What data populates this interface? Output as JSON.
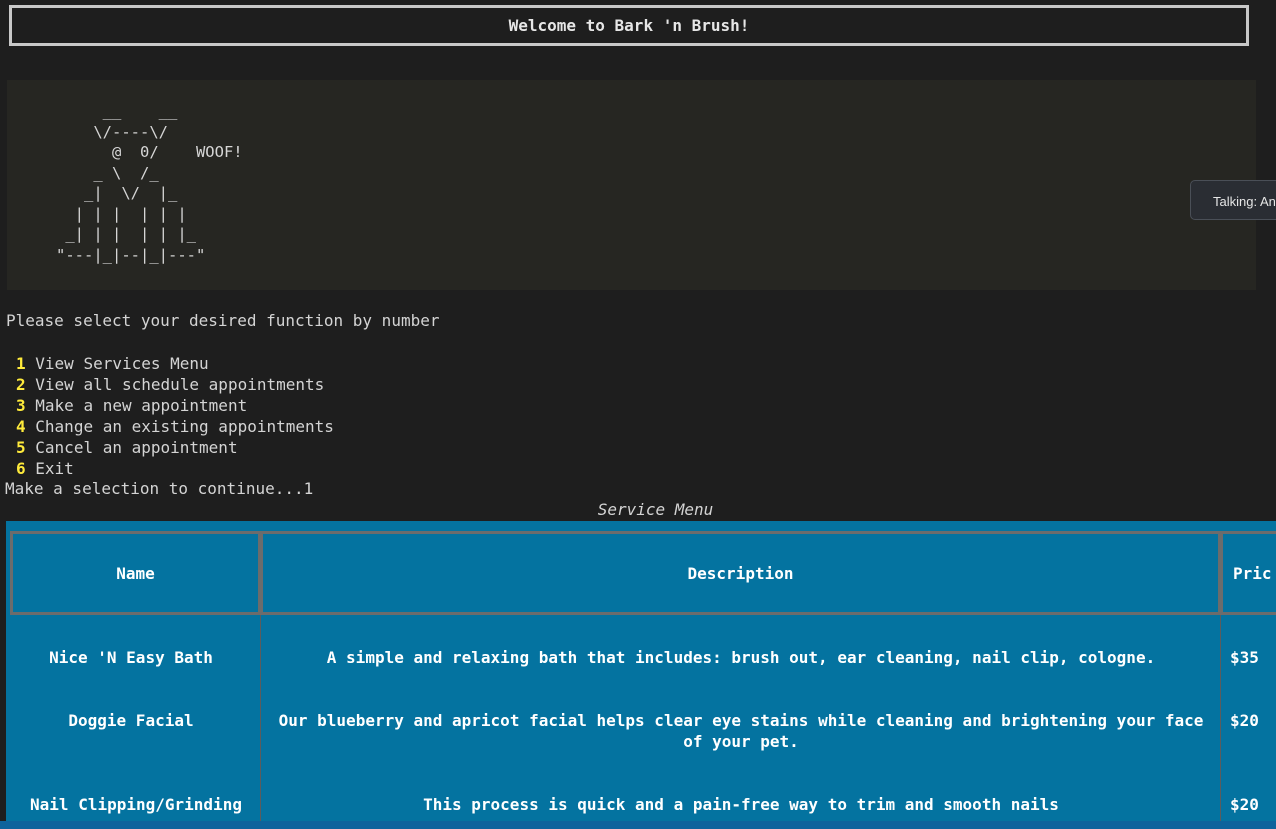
{
  "banner": {
    "title": "Welcome to Bark 'n Brush!"
  },
  "ascii_art": "     __    __\n    \\/----\\/\n      @  0/    WOOF!\n    _ \\  /_\n   _|  \\/  |_\n  | | |  | | |\n _| | |  | | |_\n\"---|_|--|_|---\"",
  "prompt": "Please select your desired function by number",
  "menu": [
    {
      "num": "1",
      "label": "View Services Menu"
    },
    {
      "num": "2",
      "label": "View all schedule appointments"
    },
    {
      "num": "3",
      "label": "Make a new appointment"
    },
    {
      "num": "4",
      "label": "Change an existing appointments"
    },
    {
      "num": "5",
      "label": "Cancel an appointment"
    },
    {
      "num": "6",
      "label": "Exit"
    }
  ],
  "selection_line": "Make a selection to continue...1",
  "service_table": {
    "title": "Service Menu",
    "headers": {
      "name": "Name",
      "description": "Description",
      "price": "Pric"
    },
    "rows": [
      {
        "name": "Nice 'N Easy Bath",
        "description": "A simple and relaxing bath that includes: brush out, ear cleaning, nail clip, cologne.",
        "price": "$35"
      },
      {
        "name": "Doggie Facial",
        "description": "Our blueberry and apricot facial helps clear eye stains while cleaning and brightening your face of your pet.",
        "price": "$20"
      },
      {
        "name": "Nail Clipping/Grinding",
        "description": "This process is quick and a pain-free way to trim and smooth nails",
        "price": "$20"
      }
    ]
  },
  "tooltip": {
    "text": "Talking: An"
  },
  "colors": {
    "table_bg": "#0473a0",
    "menu_number": "#ffeb3b",
    "terminal_bg": "#1e1e1e"
  }
}
